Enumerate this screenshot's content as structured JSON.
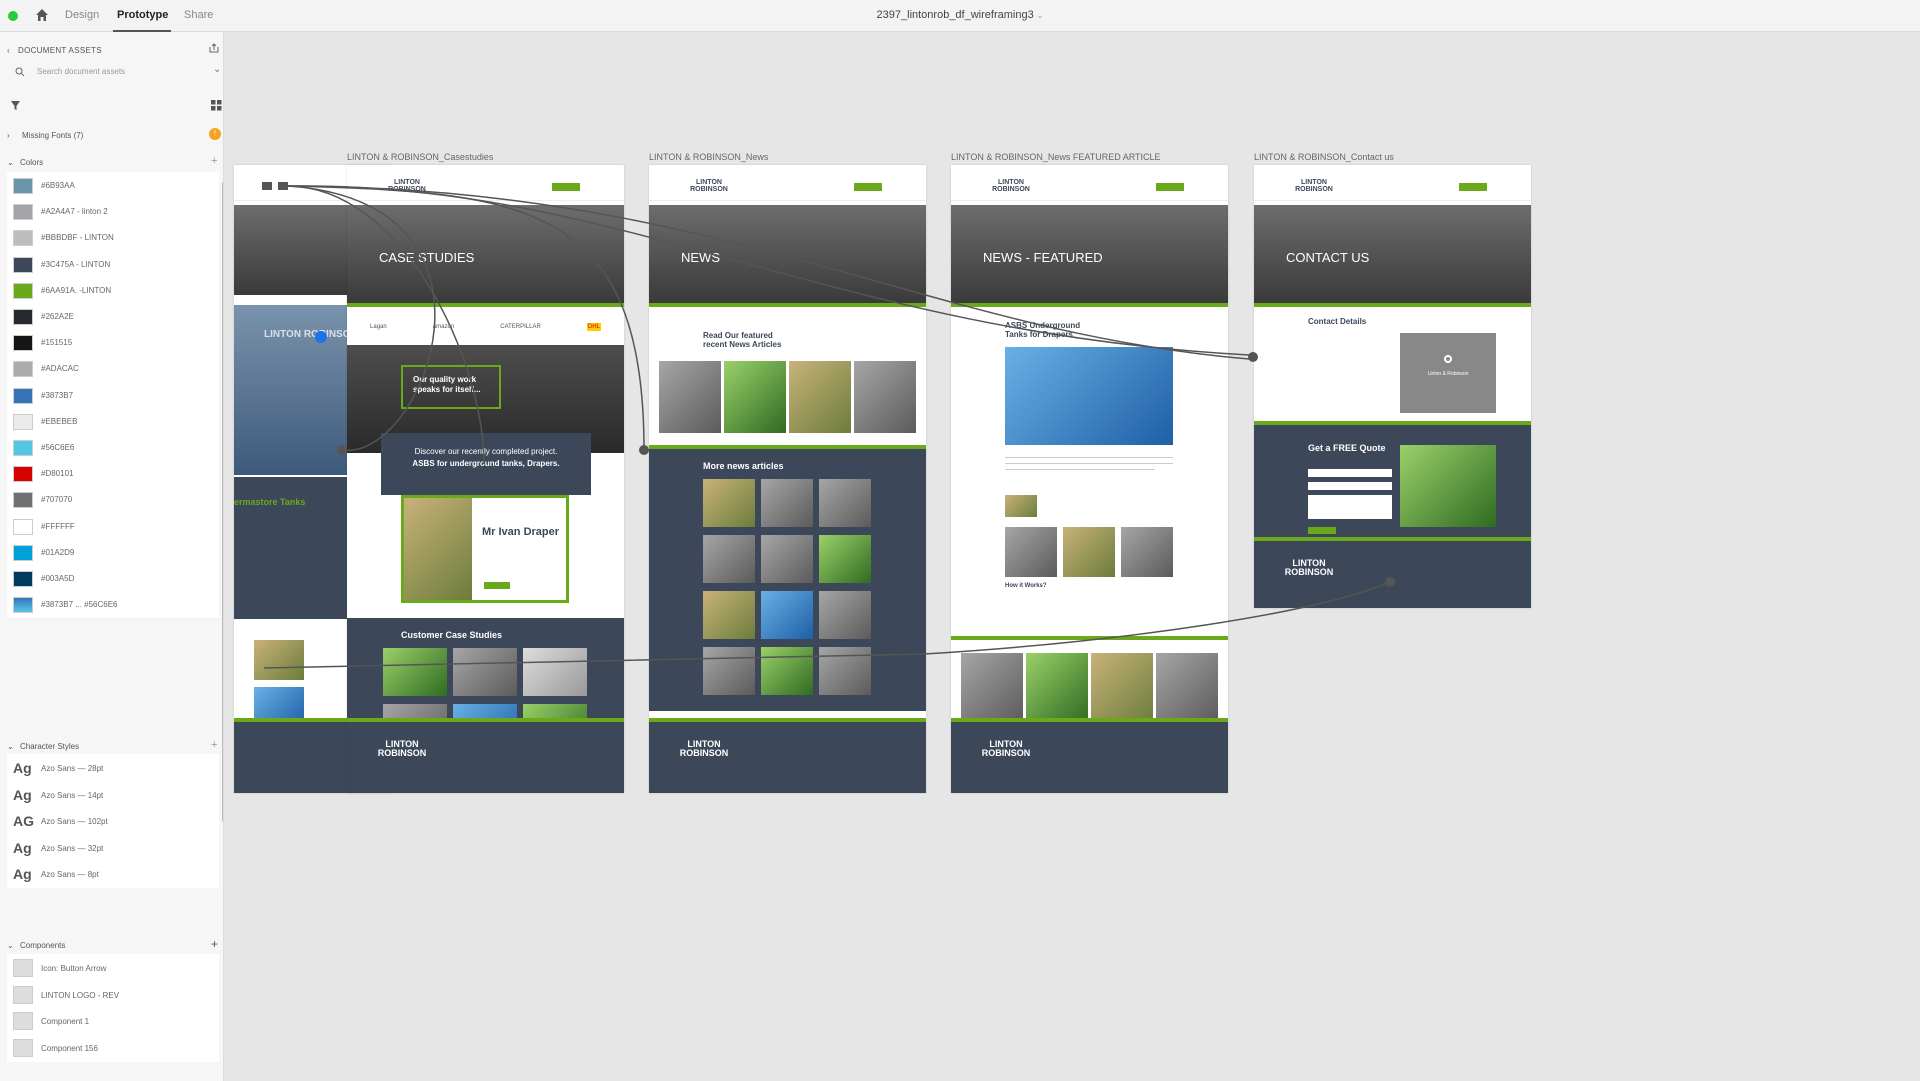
{
  "topbar": {
    "tabs": [
      "Design",
      "Prototype",
      "Share"
    ],
    "active_tab": "Prototype",
    "document_title": "2397_lintonrob_df_wireframing3"
  },
  "sidebar": {
    "header": "DOCUMENT ASSETS",
    "search_placeholder": "Search document assets",
    "missing_fonts": "Missing Fonts (7)",
    "colors_label": "Colors",
    "colors": [
      {
        "name": "#6B93AA",
        "hex": "#6B93AA"
      },
      {
        "name": "#A2A4A7 - linton 2",
        "hex": "#A2A4A7"
      },
      {
        "name": "#BBBDBF - LINTON",
        "hex": "#BBBDBF"
      },
      {
        "name": "#3C475A - LINTON",
        "hex": "#3C475A"
      },
      {
        "name": "#6AA91A. -LINTON",
        "hex": "#6AA91A"
      },
      {
        "name": "#262A2E",
        "hex": "#262A2E"
      },
      {
        "name": "#151515",
        "hex": "#151515"
      },
      {
        "name": "#ADACAC",
        "hex": "#ADACAC"
      },
      {
        "name": "#3873B7",
        "hex": "#3873B7"
      },
      {
        "name": "#EBEBEB",
        "hex": "#EBEBEB"
      },
      {
        "name": "#56C6E6",
        "hex": "#56C6E6"
      },
      {
        "name": "#D80101",
        "hex": "#D80101"
      },
      {
        "name": "#707070",
        "hex": "#707070"
      },
      {
        "name": "#FFFFFF",
        "hex": "#FFFFFF"
      },
      {
        "name": "#01A2D9",
        "hex": "#01A2D9"
      },
      {
        "name": "#003A5D",
        "hex": "#003A5D"
      },
      {
        "name": "#3873B7 ... #56C6E6",
        "hex": "#3873B7"
      }
    ],
    "character_styles_label": "Character Styles",
    "character_styles": [
      {
        "glyph": "Ag",
        "name": "Azo Sans — 28pt"
      },
      {
        "glyph": "Ag",
        "name": "Azo Sans — 14pt"
      },
      {
        "glyph": "AG",
        "name": "Azo Sans — 102pt"
      },
      {
        "glyph": "Ag",
        "name": "Azo Sans — 32pt"
      },
      {
        "glyph": "Ag",
        "name": "Azo Sans — 8pt"
      }
    ],
    "components_label": "Components",
    "components": [
      {
        "name": "Icon: Button Arrow"
      },
      {
        "name": "LINTON LOGO - REV"
      },
      {
        "name": "Component 1"
      },
      {
        "name": "Component 156"
      }
    ]
  },
  "canvas": {
    "artboards": [
      {
        "title": "",
        "hero": "",
        "logo": "LINTON ROBINSON",
        "section": "ermastore Tanks"
      },
      {
        "title": "LINTON & ROBINSON_Casestudies",
        "hero": "CASE STUDIES",
        "logo": "LINTON ROBINSON",
        "quote": "Our quality work speaks for itself...",
        "discover": "Discover our recently completed project.",
        "discover_bold": "ASBS for underground tanks, Drapers.",
        "person": "Mr Ivan Draper",
        "section": "Customer Case Studies",
        "logos": [
          "Lagan",
          "amazon",
          "CATERPILLAR",
          "DHL"
        ]
      },
      {
        "title": "LINTON & ROBINSON_News",
        "hero": "NEWS",
        "logo": "LINTON ROBINSON",
        "featured": "Read Our featured recent News Articles",
        "section": "More news articles"
      },
      {
        "title": "LINTON & ROBINSON_News FEATURED ARTICLE",
        "hero": "NEWS - FEATURED",
        "logo": "LINTON ROBINSON",
        "article": "ASBS Underground Tanks for Drapers",
        "sub": "How it Works?"
      },
      {
        "title": "LINTON & ROBINSON_Contact us",
        "hero": "CONTACT US",
        "logo": "LINTON ROBINSON",
        "contact": "Contact Details",
        "quote": "Get a FREE Quote",
        "map_label": "Linton & Robinson"
      }
    ]
  }
}
